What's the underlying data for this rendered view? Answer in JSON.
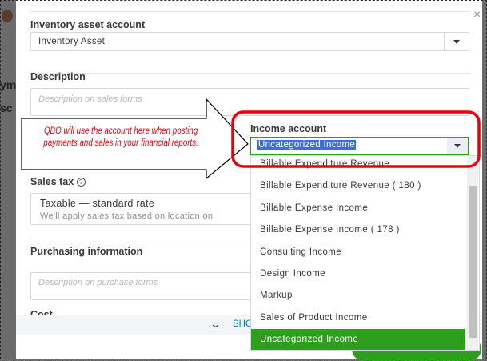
{
  "background": {
    "fragment_1": "ym",
    "fragment_2": "sc"
  },
  "modal": {
    "inventory_asset_account": {
      "label": "Inventory asset account",
      "value": "Inventory Asset"
    },
    "description": {
      "label": "Description",
      "placeholder": "Description on sales forms"
    },
    "income_account": {
      "label": "Income account",
      "value": "Uncategorized Income"
    },
    "sales_tax": {
      "label": "Sales tax",
      "title": "Taxable — standard rate",
      "subtitle": "We'll apply sales tax based on location on"
    },
    "purchasing": {
      "label": "Purchasing information",
      "placeholder": "Description on purchase forms",
      "cost_label": "Cost"
    },
    "show_more": "SHO",
    "dropdown": {
      "items": [
        "Billable Expenditure Revenue",
        "Billable Expenditure Revenue ( 180 )",
        "Billable Expense Income",
        "Billable Expense Income ( 178 )",
        "Consulting Income",
        "Design Income",
        "Markup",
        "Sales of Product Income",
        "Uncategorized Income"
      ],
      "selected": "Uncategorized Income"
    }
  },
  "callout": {
    "line1": "QBO will use the account here when posting",
    "line2": "payments and sales in your financial reports."
  },
  "colors": {
    "accent_green": "#2ca01c",
    "highlight_red": "#e8000b",
    "selection_blue": "#3a6fd8"
  }
}
